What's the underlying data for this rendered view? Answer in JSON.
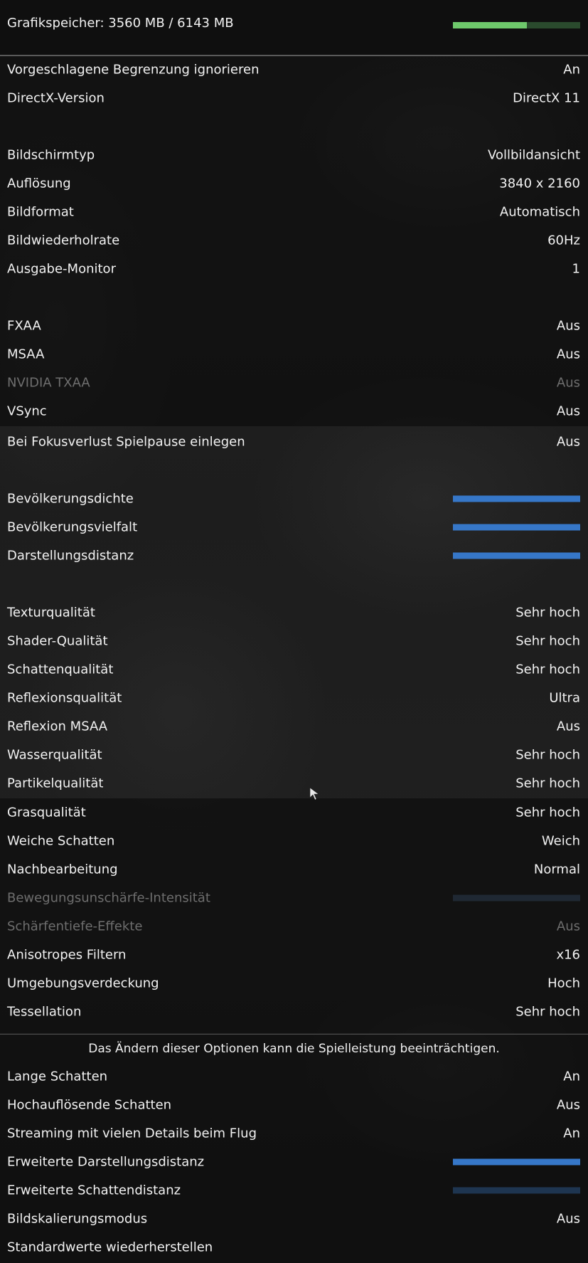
{
  "header": {
    "memory_label": "Grafikspeicher: 3560 MB / 6143 MB",
    "memory_used_fraction": 0.58,
    "memory_bar_color": "#6ec96b"
  },
  "groups": {
    "general": [
      {
        "label": "Vorgeschlagene Begrenzung ignorieren",
        "value": "An"
      },
      {
        "label": "DirectX-Version",
        "value": "DirectX 11"
      }
    ],
    "display": [
      {
        "label": "Bildschirmtyp",
        "value": "Vollbildansicht"
      },
      {
        "label": "Auflösung",
        "value": "3840 x 2160"
      },
      {
        "label": "Bildformat",
        "value": "Automatisch"
      },
      {
        "label": "Bildwiederholrate",
        "value": "60Hz"
      },
      {
        "label": "Ausgabe-Monitor",
        "value": "1"
      }
    ],
    "antialiasing": [
      {
        "label": "FXAA",
        "value": "Aus"
      },
      {
        "label": "MSAA",
        "value": "Aus"
      },
      {
        "label": "NVIDIA TXAA",
        "value": "Aus",
        "disabled": true
      },
      {
        "label": "VSync",
        "value": "Aus"
      },
      {
        "label": "Bei Fokusverlust Spielpause einlegen",
        "value": "Aus"
      }
    ],
    "sliders": [
      {
        "label": "Bevölkerungsdichte",
        "level": 1.0
      },
      {
        "label": "Bevölkerungsvielfalt",
        "level": 1.0
      },
      {
        "label": "Darstellungsdistanz",
        "level": 1.0
      }
    ],
    "quality": [
      {
        "label": "Texturqualität",
        "value": "Sehr hoch"
      },
      {
        "label": "Shader-Qualität",
        "value": "Sehr hoch"
      },
      {
        "label": "Schattenqualität",
        "value": "Sehr hoch"
      },
      {
        "label": "Reflexionsqualität",
        "value": "Ultra"
      },
      {
        "label": "Reflexion MSAA",
        "value": "Aus"
      },
      {
        "label": "Wasserqualität",
        "value": "Sehr hoch"
      },
      {
        "label": "Partikelqualität",
        "value": "Sehr hoch"
      }
    ],
    "postfx": [
      {
        "label": "Grasqualität",
        "value": "Sehr hoch"
      },
      {
        "label": "Weiche Schatten",
        "value": "Weich"
      },
      {
        "label": "Nachbearbeitung",
        "value": "Normal"
      },
      {
        "label": "Bewegungsunschärfe-Intensität",
        "level": 0.0,
        "disabled": true
      },
      {
        "label": "Schärfentiefe-Effekte",
        "value": "Aus",
        "disabled": true
      },
      {
        "label": "Anisotropes Filtern",
        "value": "x16"
      },
      {
        "label": "Umgebungsverdeckung",
        "value": "Hoch"
      },
      {
        "label": "Tessellation",
        "value": "Sehr hoch"
      }
    ],
    "advanced": [
      {
        "label": "Lange Schatten",
        "value": "An"
      },
      {
        "label": "Hochauflösende Schatten",
        "value": "Aus"
      },
      {
        "label": "Streaming mit vielen Details beim Flug",
        "value": "An"
      },
      {
        "label": "Erweiterte Darstellungsdistanz",
        "level": 1.0
      },
      {
        "label": "Erweiterte Schattendistanz",
        "level": 0.0
      },
      {
        "label": "Bildskalierungsmodus",
        "value": "Aus"
      },
      {
        "label": "Standardwerte wiederherstellen",
        "value": ""
      }
    ]
  },
  "advanced_warning": "Das Ändern dieser Optionen kann die Spielleistung beeinträchtigen.",
  "colors": {
    "slider_fill": "#3677c8",
    "slider_track": "#1e3550",
    "disabled_text": "#6e6e6e"
  }
}
